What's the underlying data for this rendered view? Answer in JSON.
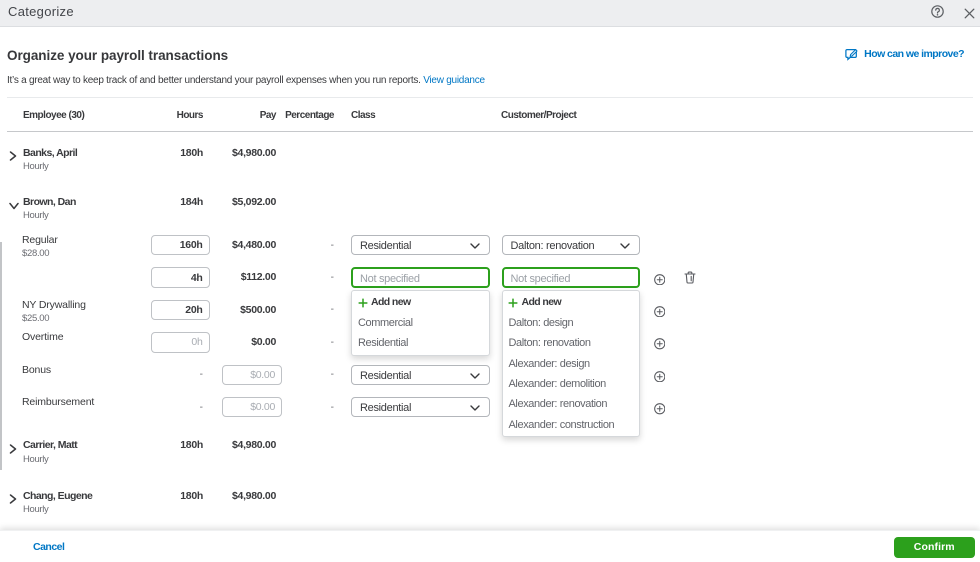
{
  "titlebar": {
    "title": "Categorize"
  },
  "header": {
    "title": "Organize your payroll transactions",
    "improve_link": "How can we improve?",
    "subtitle": "It’s a great way to keep track of and better understand your payroll expenses when you run reports.",
    "guidance_link": "View guidance"
  },
  "table": {
    "columns": {
      "employee": "Employee (30)",
      "hours": "Hours",
      "pay": "Pay",
      "percentage": "Percentage",
      "class": "Class",
      "customer": "Customer/Project"
    }
  },
  "employees": [
    {
      "name": "Banks, April",
      "type": "Hourly",
      "hours": "180h",
      "pay": "$4,980.00"
    },
    {
      "name": "Brown, Dan",
      "type": "Hourly",
      "hours": "184h",
      "pay": "$5,092.00"
    },
    {
      "name": "Carrier, Matt",
      "type": "Hourly",
      "hours": "180h",
      "pay": "$4,980.00"
    },
    {
      "name": "Chang, Eugene",
      "type": "Hourly",
      "hours": "180h",
      "pay": "$4,980.00"
    }
  ],
  "pay_items": [
    {
      "label": "Regular",
      "rate": "$28.00",
      "hours": "160h",
      "pay": "$4,480.00",
      "percentage": "-",
      "class_value": "Residential",
      "customer_value": "Dalton: renovation"
    },
    {
      "label": "",
      "rate": "",
      "hours": "4h",
      "pay": "$112.00",
      "percentage": "-",
      "class_value": "Not specified",
      "customer_value": "Not specified"
    },
    {
      "label": "NY Drywalling",
      "rate": "$25.00",
      "hours": "20h",
      "pay": "$500.00",
      "percentage": "-"
    },
    {
      "label": "Overtime",
      "rate": "",
      "hours": "0h",
      "pay": "$0.00",
      "percentage": "-"
    },
    {
      "label": "Bonus",
      "rate": "",
      "hours": "-",
      "pay": "$0.00",
      "percentage": "-",
      "class_value": "Residential"
    },
    {
      "label": "Reimbursement",
      "rate": "",
      "hours": "-",
      "pay": "$0.00",
      "percentage": "-",
      "class_value": "Residential"
    }
  ],
  "class_menu": {
    "add_label": "Add new",
    "options": [
      "Commercial",
      "Residential"
    ]
  },
  "customer_menu": {
    "add_label": "Add new",
    "options": [
      "Dalton: design",
      "Dalton: renovation",
      "Alexander: design",
      "Alexander: demolition",
      "Alexander: renovation",
      "Alexander: construction"
    ]
  },
  "footer": {
    "cancel": "Cancel",
    "confirm": "Confirm"
  },
  "colors": {
    "accent_green": "#2CA01C",
    "link_blue": "#0077C5",
    "text_dark": "#393A3D",
    "text_gray": "#6B6C72"
  }
}
